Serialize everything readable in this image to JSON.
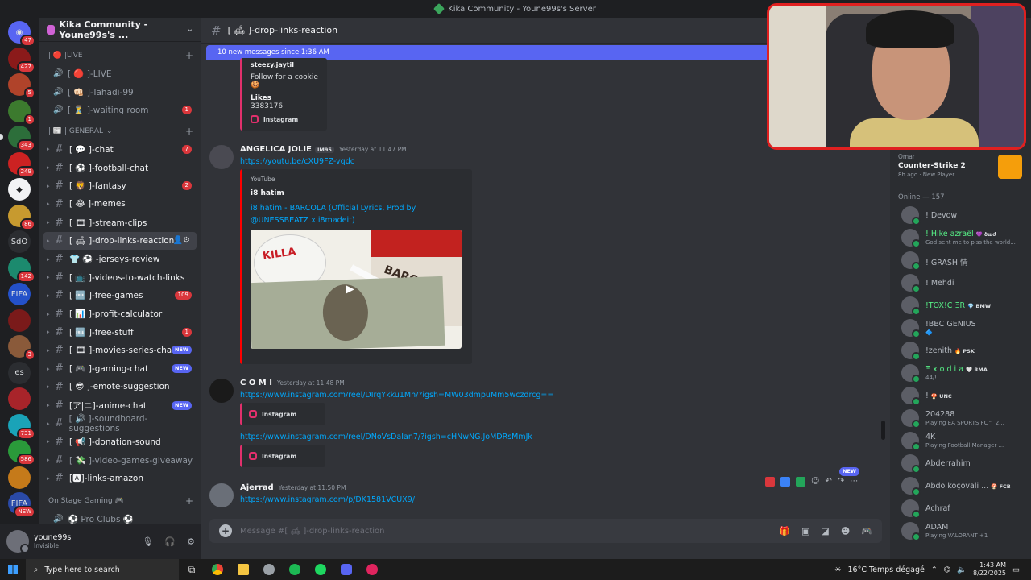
{
  "window": {
    "title": "Kika Community - Youne99s's Server"
  },
  "rail": {
    "servers": [
      {
        "label": "◉",
        "badge": "47",
        "color": "#5865f2"
      },
      {
        "label": "",
        "badge": "427",
        "color": "#8b1a1a"
      },
      {
        "label": "",
        "badge": "5",
        "color": "#b0432a"
      },
      {
        "label": "",
        "badge": "1",
        "color": "#3c7a2e"
      },
      {
        "label": "",
        "badge": "343",
        "color": "#2c6e3a"
      },
      {
        "label": "",
        "badge": "249",
        "color": "#c22"
      },
      {
        "label": "◆",
        "badge": "",
        "color": "#f2f3f5"
      },
      {
        "label": "",
        "badge": "86",
        "color": "#c79a2f"
      },
      {
        "label": "SdO",
        "badge": "",
        "color": "#2b2d31"
      },
      {
        "label": "",
        "badge": "142",
        "color": "#1c8a6e"
      },
      {
        "label": "FIFA",
        "badge": "",
        "color": "#2451c9"
      },
      {
        "label": "",
        "badge": "",
        "color": "#7a1a1a"
      },
      {
        "label": "",
        "badge": "3",
        "color": "#8a5a3a"
      },
      {
        "label": "es",
        "badge": "",
        "color": "#2b2d31"
      },
      {
        "label": "",
        "badge": "",
        "color": "#a8242a"
      },
      {
        "label": "",
        "badge": "731",
        "color": "#1aa3b8"
      },
      {
        "label": "",
        "badge": "586",
        "color": "#2a9a3a"
      },
      {
        "label": "",
        "badge": "",
        "color": "#c57a1a"
      },
      {
        "label": "FIFA",
        "badge": "NEW",
        "color": "#2a4aa8"
      }
    ]
  },
  "guild": {
    "name": "Kika Community - Youne99s's ..."
  },
  "categories": {
    "live": "| 🔴 |LIVE",
    "general": "| 📰 | GENERAL",
    "onstage": "On Stage Gaming 🎮"
  },
  "voice_live": [
    {
      "name": "[ 🔴 ]-LIVE",
      "count": ""
    },
    {
      "name": "[ 👊🏻 ]-Tahadi-99",
      "count": ""
    },
    {
      "name": "[ ⏳ ]-waiting room",
      "count": "1"
    }
  ],
  "channels": [
    {
      "name": "[ 💬 ]-chat",
      "count": "7",
      "new": "",
      "bright": true
    },
    {
      "name": "[ ⚽ ]-football-chat",
      "count": "",
      "new": "",
      "bright": true
    },
    {
      "name": "[ 🦁 ]-fantasy",
      "count": "2",
      "new": "",
      "bright": true
    },
    {
      "name": "[ 😂 ]-memes",
      "count": "",
      "new": "",
      "bright": true
    },
    {
      "name": "[ 🎞 ]-stream-clips",
      "count": "",
      "new": "",
      "bright": true
    },
    {
      "name": "[ 🛋 ]-drop-links-reaction",
      "count": "",
      "new": "",
      "bright": true
    },
    {
      "name": "👕 ⚽ -jerseys-review",
      "count": "",
      "new": "",
      "bright": true
    },
    {
      "name": "[ 📺 ]-videos-to-watch-links",
      "count": "",
      "new": "",
      "bright": true
    },
    {
      "name": "[ 🆓 ]-free-games",
      "count": "109",
      "new": "",
      "bright": true
    },
    {
      "name": "[ 📊 ]-profit-calculator",
      "count": "",
      "new": "",
      "bright": true
    },
    {
      "name": "[ 🆓 ]-free-stuff",
      "count": "1",
      "new": "",
      "bright": true
    },
    {
      "name": "[ 🎞 ]-movies-series-chat",
      "count": "",
      "new": "NEW",
      "bright": true
    },
    {
      "name": "[ 🎮 ]-gaming-chat",
      "count": "",
      "new": "NEW",
      "bright": true
    },
    {
      "name": "[ 😎 ]-emote-suggestion",
      "count": "",
      "new": "",
      "bright": true
    },
    {
      "name": "[ア|ニ]-anime-chat",
      "count": "",
      "new": "NEW",
      "bright": true
    },
    {
      "name": "[ 🔊 ]-soundboard-suggestions",
      "count": "",
      "new": "",
      "bright": false
    },
    {
      "name": "[ 📢 ]-donation-sound",
      "count": "",
      "new": "",
      "bright": true
    },
    {
      "name": "[ 💸 ]-video-games-giveaway",
      "count": "",
      "new": "",
      "bright": false
    },
    {
      "name": "[🅰]-links-amazon",
      "count": "",
      "new": "",
      "bright": true
    }
  ],
  "voice_stage": [
    {
      "name": "⚽ Pro Clubs ⚽"
    }
  ],
  "user": {
    "name": "youne99s",
    "status": "Invisible"
  },
  "channel_header": {
    "name": "[ 🛋 ]-drop-links-reaction"
  },
  "new_messages": "10 new messages since 1:36 AM",
  "messages": {
    "m0": {
      "embed_author": "steezy.jaytil",
      "embed_desc": "Follow for a cookie🍪",
      "field_name": "Likes",
      "field_value": "3383176",
      "footer": "Instagram"
    },
    "m1": {
      "author": "ANGELICA JOLIE",
      "tag": "IM95",
      "time": "Yesterday at 11:47 PM",
      "link": "https://youtu.be/cXU9FZ-vqdc",
      "embed_provider": "YouTube",
      "embed_author": "i8 hatim",
      "embed_title_1": "i8 hatim - BARCOLA (Official Lyrics, Prod by",
      "embed_title_2": "@UNESSBEATZ x i8madeit)",
      "tin_text": "KILLA",
      "pack_text": "BARCOLA"
    },
    "m2": {
      "author": "C O M I",
      "time": "Yesterday at 11:48 PM",
      "link1": "https://www.instagram.com/reel/DIrqYkku1Mn/?igsh=MW03dmpuMm5wczdrcg==",
      "footer1": "Instagram",
      "link2": "https://www.instagram.com/reel/DNoVsDaIan7/?igsh=cHNwNG.JoMDRsMmJk",
      "footer2": "Instagram"
    },
    "m3": {
      "author": "Ajerrad",
      "time": "Yesterday at 11:50 PM",
      "link": "https://www.instagram.com/p/DK1581VCUX9/"
    }
  },
  "hover_new": "NEW",
  "composer": {
    "placeholder": "Message #[ 🛋 ]-drop-links-reaction"
  },
  "activity": {
    "user": "Omar",
    "game": "Counter-Strike 2",
    "meta": "8h ago · New Player"
  },
  "online_header": "Online — 157",
  "members": [
    {
      "name": "! Devow",
      "status": "",
      "tag": "",
      "color": "#b5bac1"
    },
    {
      "name": "! Hike azraël",
      "status": "God sent me to piss the world...",
      "tag": "💜 ծաժ",
      "color": "#57f287"
    },
    {
      "name": "! GRASH 情",
      "status": "",
      "tag": "",
      "color": "#b5bac1"
    },
    {
      "name": "! Mehdi",
      "status": "",
      "tag": "",
      "color": "#b5bac1"
    },
    {
      "name": "!TOX!C ΞR",
      "status": "",
      "tag": "💎 BMW",
      "color": "#57f287"
    },
    {
      "name": "!BBC GENIUS",
      "status": "🔷",
      "tag": "",
      "color": "#b5bac1"
    },
    {
      "name": "!zenith",
      "status": "",
      "tag": "🔥 PSK",
      "color": "#b5bac1"
    },
    {
      "name": "Ξ x o d i a",
      "status": "44/!",
      "tag": "🤍 RMA",
      "color": "#57f287"
    },
    {
      "name": "!",
      "status": "",
      "tag": "🍄 UNC",
      "color": "#b5bac1"
    },
    {
      "name": "204288",
      "status": "Playing EA SPORTS FC™ 2...",
      "tag": "",
      "color": "#b5bac1"
    },
    {
      "name": "4K",
      "status": "Playing Football Manager ...",
      "tag": "",
      "color": "#b5bac1"
    },
    {
      "name": "Abderrahim",
      "status": "",
      "tag": "",
      "color": "#b5bac1"
    },
    {
      "name": "Abdo koçovali ...",
      "status": "",
      "tag": "🍄 FCB",
      "color": "#b5bac1"
    },
    {
      "name": "Achraf",
      "status": "",
      "tag": "",
      "color": "#b5bac1"
    },
    {
      "name": "ADAM",
      "status": "Playing VALORANT +1",
      "tag": "",
      "color": "#b5bac1"
    }
  ],
  "taskbar": {
    "search_placeholder": "Type here to search",
    "weather": "16°C  Temps dégagé",
    "time": "1:43 AM",
    "date": "8/22/2025"
  }
}
